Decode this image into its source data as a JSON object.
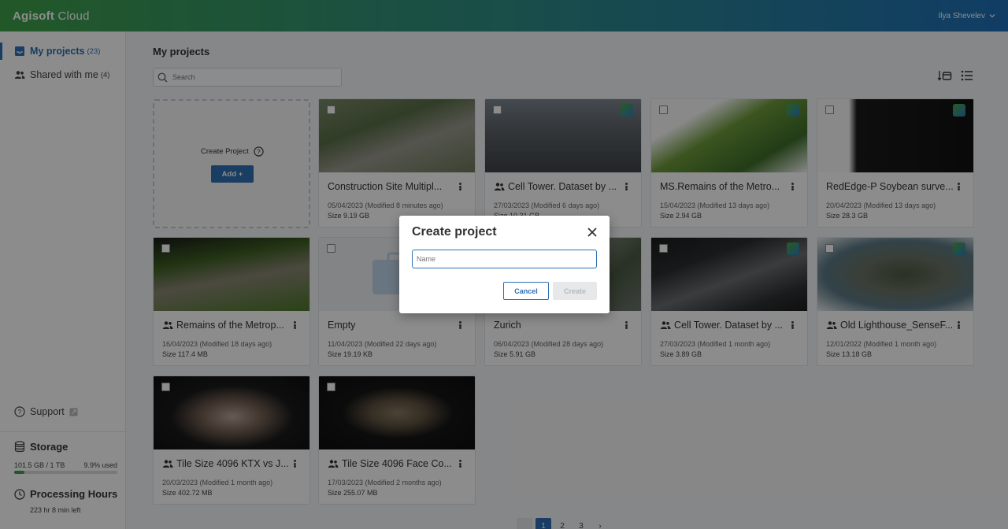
{
  "header": {
    "logo_bold": "Agisoft",
    "logo_thin": " Cloud",
    "user_name": "Ilya Shevelev"
  },
  "sidebar": {
    "items": [
      {
        "label": "My projects",
        "count": "(23)"
      },
      {
        "label": "Shared with me",
        "count": "(4)"
      }
    ],
    "support_label": "Support",
    "storage": {
      "title": "Storage",
      "used": "101.5 GB / 1 TB",
      "percent_label": "9.9% used",
      "percent": 9.9
    },
    "processing": {
      "title": "Processing Hours",
      "left": "223 hr 8 min left"
    }
  },
  "main": {
    "title": "My projects",
    "search_placeholder": "Search",
    "create_card": {
      "label": "Create Project",
      "add_label": "Add +"
    },
    "projects": [
      {
        "title": "Construction Site Multipl...",
        "date": "05/04/2023 (Modified 8 minutes ago)",
        "size": "Size 9.19 GB",
        "shared": false
      },
      {
        "title": "Cell Tower. Dataset by ...",
        "date": "27/03/2023 (Modified 6 days ago)",
        "size": "Size 10.31 GB",
        "shared": true
      },
      {
        "title": "MS.Remains of the Metro...",
        "date": "15/04/2023 (Modified 13 days ago)",
        "size": "Size 2.94 GB",
        "shared": false
      },
      {
        "title": "RedEdge-P Soybean surve...",
        "date": "20/04/2023 (Modified 13 days ago)",
        "size": "Size 28.3 GB",
        "shared": false
      },
      {
        "title": "Remains of the Metrop...",
        "date": "16/04/2023 (Modified 18 days ago)",
        "size": "Size 117.4 MB",
        "shared": true
      },
      {
        "title": "Empty",
        "date": "11/04/2023 (Modified 22 days ago)",
        "size": "Size 19.19 KB",
        "shared": false
      },
      {
        "title": "Zurich",
        "date": "06/04/2023 (Modified 28 days ago)",
        "size": "Size 5.91 GB",
        "shared": false
      },
      {
        "title": "Cell Tower. Dataset by ...",
        "date": "27/03/2023 (Modified 1 month ago)",
        "size": "Size 3.89 GB",
        "shared": true
      },
      {
        "title": "Old Lighthouse_SenseF...",
        "date": "12/01/2022 (Modified 1 month ago)",
        "size": "Size 13.18 GB",
        "shared": true
      },
      {
        "title": "Tile Size 4096 KTX vs J...",
        "date": "20/03/2023 (Modified 1 month ago)",
        "size": "Size 402.72 MB",
        "shared": true
      },
      {
        "title": "Tile Size 4096 Face Co...",
        "date": "17/03/2023 (Modified 2 months ago)",
        "size": "Size 255.07 MB",
        "shared": true
      }
    ],
    "pagination": {
      "prev": "",
      "pages": [
        "1",
        "2",
        "3"
      ],
      "next": "›",
      "current": "1"
    }
  },
  "dialog": {
    "title": "Create project",
    "name_placeholder": "Name",
    "cancel_label": "Cancel",
    "create_label": "Create"
  },
  "colors": {
    "accent": "#2e6fb5",
    "brand_green": "#3fa04a"
  }
}
